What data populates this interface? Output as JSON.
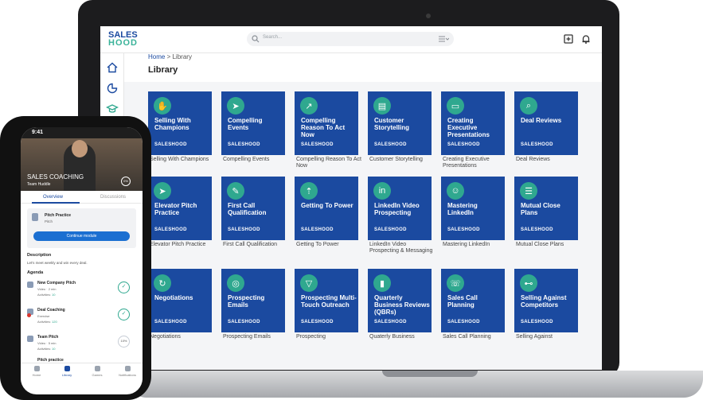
{
  "app": {
    "logo_line1": "SALES",
    "logo_line2": "HOOD",
    "search_placeholder": "Search...",
    "breadcrumb_home": "Home",
    "breadcrumb_sep": ">",
    "breadcrumb_current": "Library",
    "page_title": "Library",
    "brand_color": "#1b4aa0",
    "accent_color": "#2fa88f"
  },
  "library": {
    "tile_brand": "SALESHOOD",
    "rows": [
      [
        {
          "title": "Selling With Champions",
          "label": "Selling With Champions",
          "icon": "handshake-icon"
        },
        {
          "title": "Compelling Events",
          "label": "Compelling Events",
          "icon": "megaphone-icon"
        },
        {
          "title": "Compelling Reason To Act Now",
          "label": "Compelling Reason To Act Now",
          "icon": "chart-up-icon"
        },
        {
          "title": "Customer Storytelling",
          "label": "Customer Storytelling",
          "icon": "book-icon"
        },
        {
          "title": "Creating Executive Presentations",
          "label": "Creating Executive Presentations",
          "icon": "presentation-icon"
        },
        {
          "title": "Deal Reviews",
          "label": "Deal Reviews",
          "icon": "search-doc-icon"
        }
      ],
      [
        {
          "title": "Elevator Pitch Practice",
          "label": "Elevator Pitch Practice",
          "icon": "megaphone-icon"
        },
        {
          "title": "First Call Qualification",
          "label": "First Call Qualification",
          "icon": "clipboard-icon"
        },
        {
          "title": "Getting To Power",
          "label": "Getting To Power",
          "icon": "growth-icon"
        },
        {
          "title": "LinkedIn Video Prospecting",
          "label": "LinkedIn Video Prospecting & Messaging",
          "icon": "linkedin-icon"
        },
        {
          "title": "Mastering LinkedIn",
          "label": "Mastering LinkedIn",
          "icon": "person-icon"
        },
        {
          "title": "Mutual Close Plans",
          "label": "Mutual Close Plans",
          "icon": "checklist-icon"
        }
      ],
      [
        {
          "title": "Negotiations",
          "label": "Negotiations",
          "icon": "refresh-icon"
        },
        {
          "title": "Prospecting Emails",
          "label": "Prospecting Emails",
          "icon": "target-icon"
        },
        {
          "title": "Prospecting Multi-Touch Outreach",
          "label": "Prospecting",
          "icon": "funnel-icon"
        },
        {
          "title": "Quarterly Business Reviews (QBRs)",
          "label": "Quaterly Business",
          "icon": "bar-chart-icon"
        },
        {
          "title": "Sales Call Planning",
          "label": "Sales Call Planning",
          "icon": "phone-icon"
        },
        {
          "title": "Selling Against Competitors",
          "label": "Selling Against",
          "icon": "dumbbell-icon"
        }
      ]
    ]
  },
  "phone": {
    "time": "9:41",
    "video_title": "SALES COACHING",
    "video_sub": "Team Huddle",
    "video_badge": "0%",
    "tab_overview": "Overview",
    "tab_discussions": "Discussions",
    "module_title": "Pitch Practice",
    "module_sub": "Pitch",
    "module_button": "Continue module",
    "description_heading": "Description",
    "description_text": "Let's meet weekly and win every deal.",
    "agenda_heading": "Agenda",
    "agenda": [
      {
        "title": "New Company Pitch",
        "line1": "Video · 2 min",
        "line2_label": "Activities:",
        "line2_value": "10",
        "status": "✓"
      },
      {
        "title": "Deal Coaching",
        "line1": "Exercise",
        "line2_label": "Activities:",
        "line2_value": "120",
        "status": "✓"
      },
      {
        "title": "Team Pitch",
        "line1": "Video · 5 min",
        "line2_label": "Activities:",
        "line2_value": "10",
        "status": "10%"
      },
      {
        "title": "Pitch practice",
        "line1": "",
        "line2_label": "",
        "line2_value": "",
        "status": ""
      }
    ],
    "nav": [
      "Home",
      "Library",
      "Games",
      "Notifications"
    ]
  }
}
